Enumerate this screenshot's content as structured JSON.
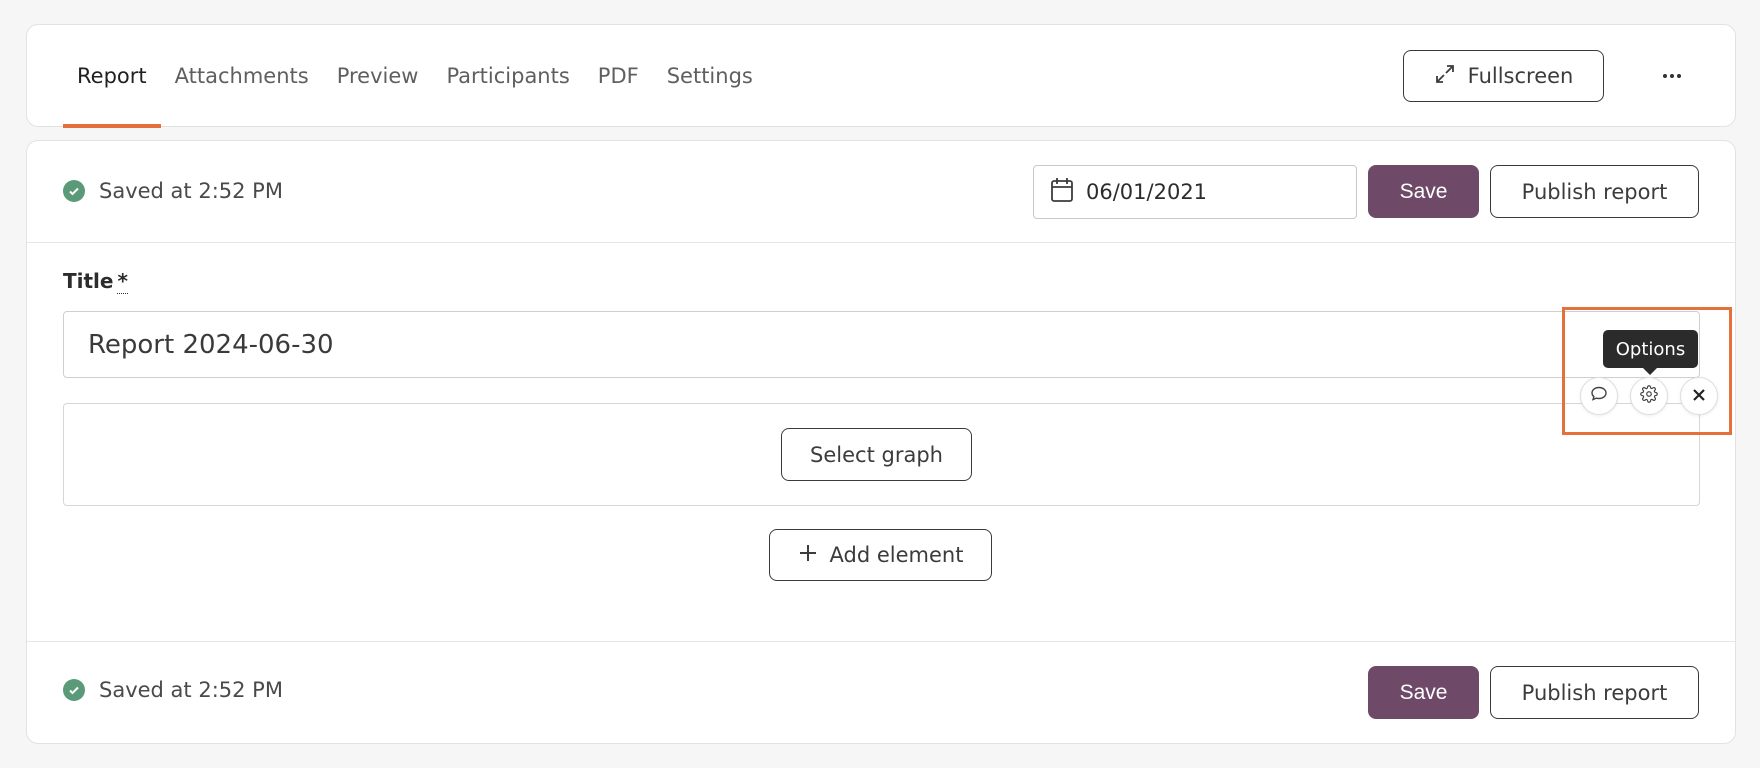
{
  "tabs": [
    {
      "label": "Report"
    },
    {
      "label": "Attachments"
    },
    {
      "label": "Preview"
    },
    {
      "label": "Participants"
    },
    {
      "label": "PDF"
    },
    {
      "label": "Settings"
    }
  ],
  "header": {
    "fullscreen_label": "Fullscreen",
    "active_tab_color": "#e5703b"
  },
  "toolbar": {
    "saved_status": "Saved at 2:52 PM",
    "date_value": "06/01/2021",
    "save_label": "Save",
    "publish_label": "Publish report",
    "save_color": "#6e4a68"
  },
  "form": {
    "title_label": "Title",
    "required_mark": "*",
    "title_value": "Report 2024-06-30",
    "select_graph_label": "Select graph",
    "add_element_label": "Add element"
  },
  "element_controls": {
    "tooltip": "Options",
    "icons": [
      "comment-icon",
      "gear-icon",
      "close-icon"
    ],
    "highlight_color": "#e5703b"
  },
  "footer": {
    "saved_status": "Saved at 2:52 PM",
    "save_label": "Save",
    "publish_label": "Publish report"
  }
}
